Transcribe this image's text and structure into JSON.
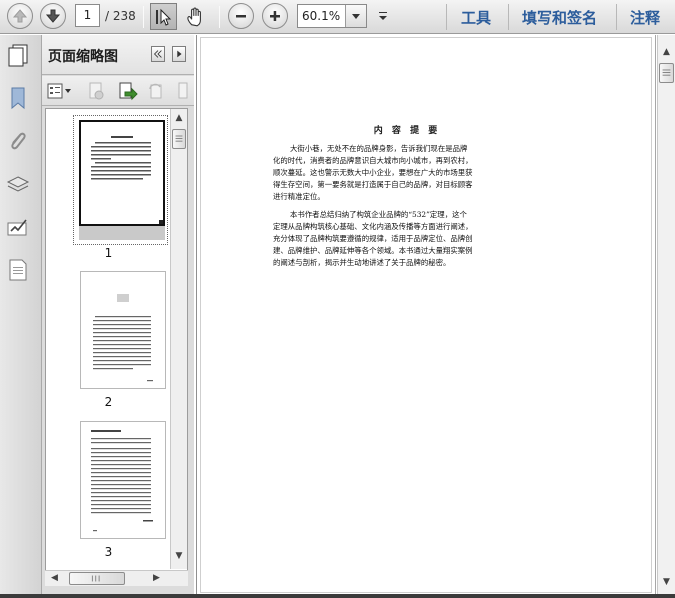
{
  "toolbar": {
    "current_page": "1",
    "total_pages": "/ 238",
    "zoom": "60.1%",
    "menu": [
      "工具",
      "填写和签名",
      "注释"
    ]
  },
  "panel": {
    "title": "页面缩略图",
    "thumbnails": [
      {
        "page": "1"
      },
      {
        "page": "2"
      },
      {
        "page": "3"
      }
    ]
  },
  "document": {
    "title": "内 容 提 要",
    "lines": [
      "大街小巷，无处不在的品牌身影，告诉我们现在是品牌",
      "化的时代，消费者的品牌意识自大城市向小城市，再到农村，",
      "顺次蔓延。这也警示无数大中小企业，要想在广大的市场里获",
      "得生存空间，第一要务就是打造属于自己的品牌，对目标顾客",
      "进行精准定位。",
      "本书作者总结归纳了构筑企业品牌的“532”定理，这个",
      "定理从品牌构筑核心基础、文化内涵及传播等方面进行阐述，",
      "充分体现了品牌构筑要遵循的规律，适用于品牌定位、品牌创",
      "建、品牌维护、品牌延伸等各个领域。本书通过大量翔实案例",
      "的阐述与剖析，揭示并生动地讲述了关于品牌的秘密。"
    ]
  },
  "colors": {
    "menu_text": "#2c5d9c",
    "toolbar_bg": "#dcdcdc"
  },
  "icons": [
    "arrow-up-icon",
    "arrow-down-icon",
    "select-cursor-icon",
    "hand-icon",
    "zoom-out-icon",
    "zoom-in-icon",
    "bookmark-icon",
    "paperclip-icon",
    "layers-icon",
    "signature-icon",
    "page-icon"
  ]
}
